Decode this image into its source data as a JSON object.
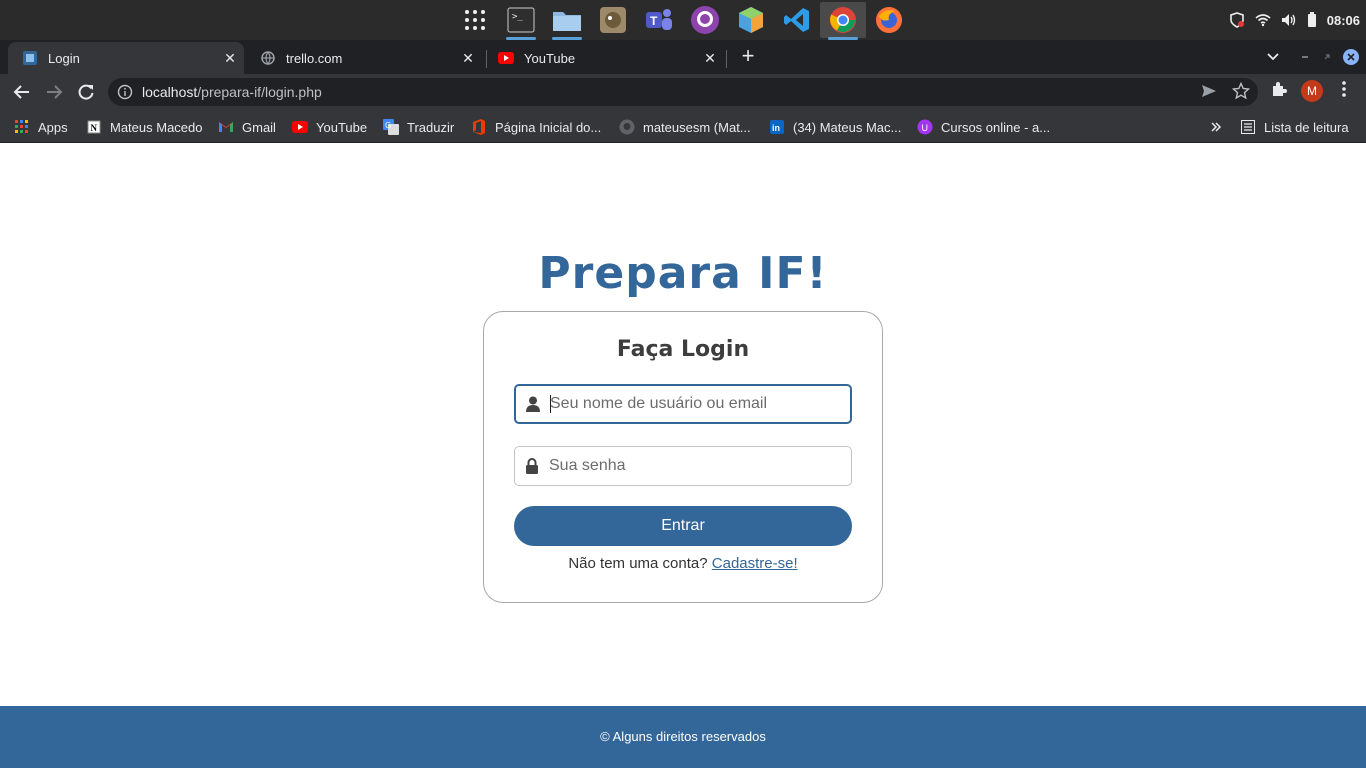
{
  "system": {
    "dock_icons": [
      "apps-grid-icon",
      "terminal-icon",
      "files-icon",
      "gimp-icon",
      "teams-icon",
      "github-icon",
      "virtualbox-icon",
      "vscode-icon",
      "chrome-icon",
      "firefox-icon"
    ],
    "clock": "08:06"
  },
  "tabs": [
    {
      "label": "Login",
      "icon": "page-favicon",
      "active": true
    },
    {
      "label": "trello.com",
      "icon": "globe-icon",
      "active": false
    },
    {
      "label": "YouTube",
      "icon": "youtube-icon",
      "active": false
    }
  ],
  "toolbar": {
    "url_host": "localhost",
    "url_path": "/prepara-if/login.php",
    "avatar_letter": "M"
  },
  "bookmarks": [
    {
      "label": "Apps",
      "icon": "apps-icon"
    },
    {
      "label": "Mateus Macedo",
      "icon": "notion-icon"
    },
    {
      "label": "Gmail",
      "icon": "gmail-icon"
    },
    {
      "label": "YouTube",
      "icon": "youtube-icon"
    },
    {
      "label": "Traduzir",
      "icon": "translate-icon"
    },
    {
      "label": "Página Inicial do...",
      "icon": "office-icon"
    },
    {
      "label": "mateusesm (Mat...",
      "icon": "github-icon"
    },
    {
      "label": "(34) Mateus Mac...",
      "icon": "linkedin-icon"
    },
    {
      "label": "Cursos online - a...",
      "icon": "udemy-icon"
    }
  ],
  "reading_list": "Lista de leitura",
  "page": {
    "brand": "Prepara IF!",
    "card_title": "Faça Login",
    "username_placeholder": "Seu nome de usuário ou email",
    "password_placeholder": "Sua senha",
    "submit_label": "Entrar",
    "signup_prompt": "Não tem uma conta?",
    "signup_link": "Cadastre-se!"
  },
  "footer": "© Alguns direitos reservados",
  "colors": {
    "brand": "#336699",
    "footer_bg": "#336699"
  }
}
